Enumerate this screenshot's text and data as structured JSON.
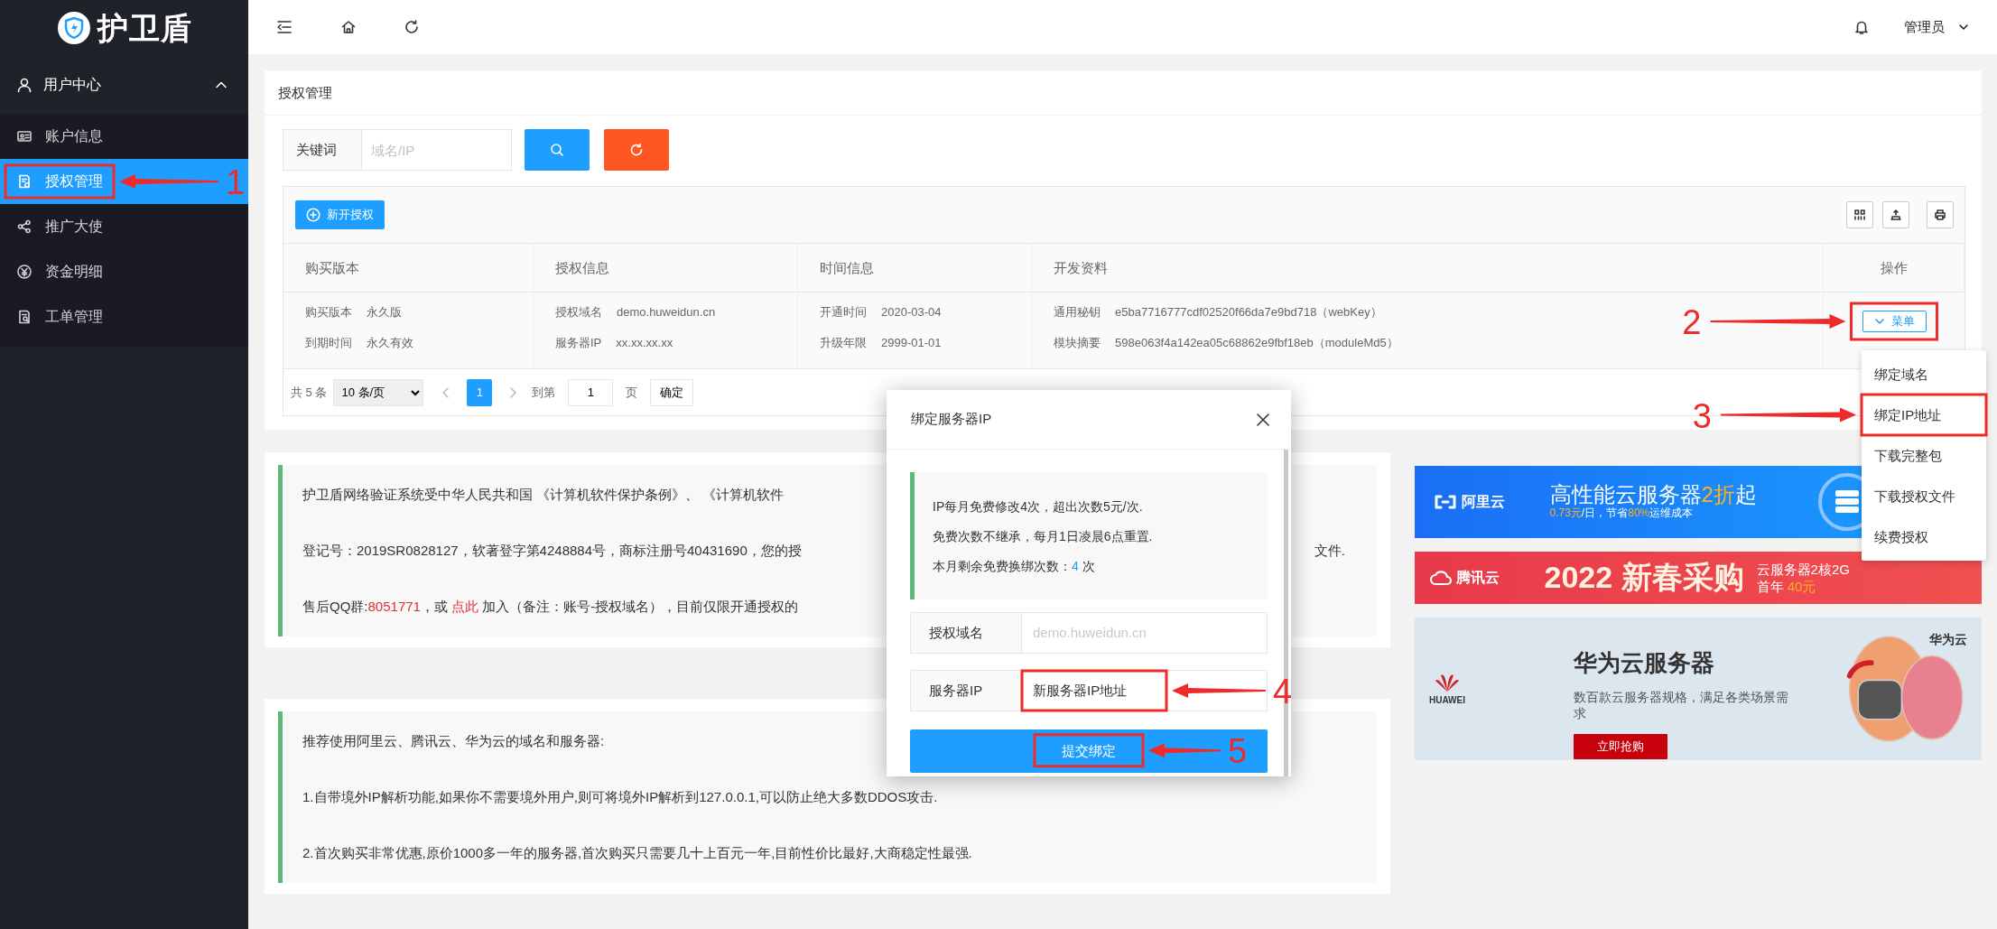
{
  "sidebar": {
    "logo_text": "护卫盾",
    "group": {
      "label": "用户中心",
      "expanded": true,
      "items": [
        {
          "label": "账户信息",
          "selected": false
        },
        {
          "label": "授权管理",
          "selected": true
        },
        {
          "label": "推广大使",
          "selected": false
        },
        {
          "label": "资金明细",
          "selected": false
        },
        {
          "label": "工单管理",
          "selected": false
        }
      ]
    }
  },
  "header": {
    "user": "管理员"
  },
  "panel": {
    "title": "授权管理",
    "search": {
      "label": "关键词",
      "placeholder": "域名/IP"
    },
    "new_button": "新开授权",
    "columns": [
      "购买版本",
      "授权信息",
      "时间信息",
      "开发资料",
      "操作"
    ],
    "rows": [
      {
        "cells": [
          [
            {
              "label": "购买版本",
              "value": "永久版"
            },
            {
              "label": "到期时间",
              "value": "永久有效"
            }
          ],
          [
            {
              "label": "授权域名",
              "value": "demo.huweidun.cn"
            },
            {
              "label": "服务器IP",
              "value": "xx.xx.xx.xx"
            }
          ],
          [
            {
              "label": "开通时间",
              "value": "2020-03-04"
            },
            {
              "label": "升级年限",
              "value": "2999-01-01"
            }
          ],
          [
            {
              "label": "通用秘钥",
              "value": "e5ba7716777cdf02520f66da7e9bd718（webKey）"
            },
            {
              "label": "模块摘要",
              "value": "598e063f4a142ea05c68862e9fbf18eb（moduleMd5）"
            }
          ]
        ],
        "action": "菜单"
      }
    ],
    "pagination": {
      "total": "共 5 条",
      "page_size": "10 条/页",
      "pages": [
        {
          "label": "1",
          "selected": true
        }
      ],
      "goto_label": "到第",
      "goto_value": "1",
      "page_unit": "页",
      "confirm": "确定"
    }
  },
  "notices": [
    {
      "lines": [
        {
          "parts": [
            {
              "text": "护卫盾网络验证系统受中华人民共和国 《计算机软件保护条例》、 《计算机软件",
              "kind": "plain"
            }
          ]
        },
        {
          "parts": [
            {
              "text": "登记号：2019SR0828127，软著登字第4248884号，商标注册号40431690，您的授",
              "kind": "plain"
            }
          ],
          "tail": "文件."
        },
        {
          "parts": [
            {
              "text": "售后QQ群:",
              "kind": "plain"
            },
            {
              "text": "8051771",
              "kind": "number"
            },
            {
              "text": "，或 ",
              "kind": "plain"
            },
            {
              "text": "点此",
              "kind": "link"
            },
            {
              "text": " 加入（备注：账号-授权域名），目前仅限开通授权的",
              "kind": "plain"
            }
          ]
        }
      ]
    },
    {
      "lines": [
        {
          "parts": [
            {
              "text": "推荐使用阿里云、腾讯云、华为云的域名和服务器:",
              "kind": "plain"
            }
          ]
        },
        {
          "parts": [
            {
              "text": "1.自带境外IP解析功能,如果你不需要境外用户,则可将境外IP解析到127.0.0.1,可以防止绝大多数DDOS攻击.",
              "kind": "plain"
            }
          ]
        },
        {
          "parts": [
            {
              "text": "2.首次购买非常优惠,原价1000多一年的服务器,首次购买只需要几十上百元一年,目前性价比最好,大商稳定性最强.",
              "kind": "plain"
            }
          ]
        }
      ]
    }
  ],
  "ads": [
    {
      "kind": "aliyun",
      "brand": "阿里云",
      "headline": [
        {
          "text": "高性能云服务器",
          "kind": "plain"
        },
        {
          "text": "2折",
          "kind": "accent"
        },
        {
          "text": "起",
          "kind": "plain"
        }
      ],
      "lines": [
        [
          {
            "text": "0.73元",
            "kind": "accent"
          },
          {
            "text": "/日，节省",
            "kind": "plain"
          },
          {
            "text": "80%",
            "kind": "accent"
          },
          {
            "text": "运维成本",
            "kind": "plain"
          }
        ]
      ]
    },
    {
      "kind": "tencent",
      "brand": "腾讯云",
      "headline": [
        {
          "text": "2022 新春采购",
          "kind": "plain"
        }
      ],
      "lines": [
        [
          {
            "text": "云服务器2核2G",
            "kind": "plain"
          }
        ],
        [
          {
            "text": "首年 ",
            "kind": "plain"
          },
          {
            "text": "40元",
            "kind": "accent"
          }
        ]
      ]
    },
    {
      "kind": "huawei",
      "brand": "HUAWEI",
      "corner": "华为云",
      "headline": [
        {
          "text": "华为云服务器",
          "kind": "plain"
        }
      ],
      "lines": [
        [
          {
            "text": "数百款云服务器规格，满足各类场景需求",
            "kind": "plain"
          }
        ]
      ],
      "button": "立即抢购"
    }
  ],
  "dropdown": {
    "items": [
      {
        "label": "绑定域名"
      },
      {
        "label": "绑定IP地址"
      },
      {
        "label": "下载完整包"
      },
      {
        "label": "下载授权文件"
      },
      {
        "label": "续费授权"
      }
    ]
  },
  "modal": {
    "title": "绑定服务器IP",
    "info": [
      [
        {
          "text": "IP每月免费修改4次，超出次数5元/次.",
          "kind": "plain"
        }
      ],
      [
        {
          "text": "免费次数不继承，每月1日凌晨6点重置.",
          "kind": "plain"
        }
      ],
      [
        {
          "text": "本月剩余免费换绑次数：",
          "kind": "plain"
        },
        {
          "text": "4",
          "kind": "count"
        },
        {
          "text": " 次",
          "kind": "plain"
        }
      ]
    ],
    "fields": [
      {
        "label": "授权域名",
        "placeholder": "demo.huweidun.cn"
      },
      {
        "label": "服务器IP",
        "value": "新服务器IP地址"
      }
    ],
    "submit": "提交绑定"
  },
  "annotations": [
    {
      "label": "1"
    },
    {
      "label": "2"
    },
    {
      "label": "3"
    },
    {
      "label": "4"
    },
    {
      "label": "5"
    }
  ]
}
